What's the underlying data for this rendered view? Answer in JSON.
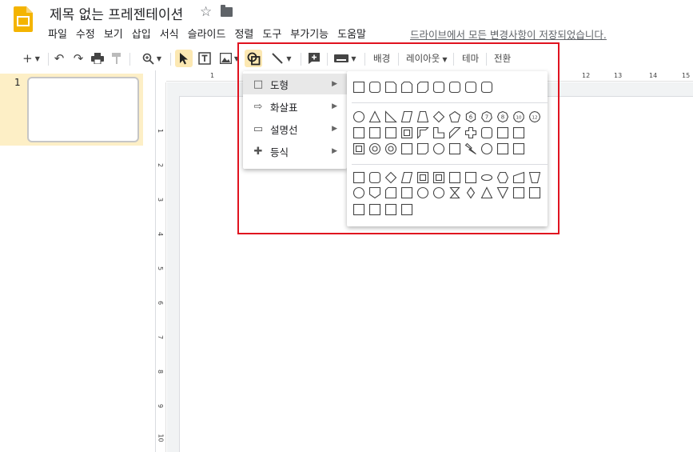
{
  "app": {
    "title": "제목 없는 프레젠테이션",
    "save_status": "드라이브에서 모든 변경사항이 저장되었습니다."
  },
  "menu": [
    "파일",
    "수정",
    "보기",
    "삽입",
    "서식",
    "슬라이드",
    "정렬",
    "도구",
    "부가기능",
    "도움말"
  ],
  "toolbar": {
    "background_label": "배경",
    "layout_label": "레이아웃",
    "theme_label": "테마",
    "transition_label": "전환"
  },
  "slides": [
    {
      "number": "1"
    }
  ],
  "rulers": {
    "horizontal": [
      "1",
      "12",
      "13",
      "14",
      "15"
    ],
    "vertical": [
      "1",
      "2",
      "3",
      "4",
      "5",
      "6",
      "7",
      "8",
      "9",
      "10"
    ]
  },
  "shape_menu": {
    "items": [
      {
        "label": "도형",
        "icon": "rectangle-icon"
      },
      {
        "label": "화살표",
        "icon": "arrow-right-icon"
      },
      {
        "label": "설명선",
        "icon": "callout-icon"
      },
      {
        "label": "등식",
        "icon": "plus-icon"
      }
    ]
  },
  "shape_panel": {
    "rows": [
      {
        "group": "rectangles",
        "shapes": [
          "rectangle",
          "rounded-rectangle",
          "snip-single-corner",
          "snip-same-side",
          "snip-diagonal",
          "snip-round-single",
          "round-single-corner",
          "round-same-side",
          "round-diagonal"
        ]
      },
      {
        "group": "basic",
        "shapes": [
          "oval",
          "triangle",
          "right-triangle",
          "parallelogram",
          "trapezoid",
          "diamond",
          "pentagon",
          "hexagon-6",
          "heptagon-7",
          "octagon-8",
          "decagon-10",
          "dodecagon-12"
        ]
      },
      {
        "group": "basic",
        "shapes": [
          "pie",
          "chord",
          "teardrop",
          "frame",
          "half-frame",
          "l-shape",
          "diagonal-stripe",
          "cross",
          "plaque",
          "can",
          "cube"
        ]
      },
      {
        "group": "basic",
        "shapes": [
          "bevel",
          "donut",
          "no-symbol",
          "block-arc",
          "folded-corner",
          "smiley",
          "heart",
          "lightning-bolt",
          "sun",
          "moon",
          "cloud"
        ]
      },
      {
        "group": "flowchart",
        "shapes": [
          "process",
          "alternate-process",
          "decision",
          "data",
          "predefined-process",
          "internal-storage",
          "document",
          "multidocument",
          "terminator",
          "preparation",
          "manual-input",
          "manual-operation"
        ]
      },
      {
        "group": "flowchart",
        "shapes": [
          "connector",
          "off-page-connector",
          "card",
          "punched-tape",
          "summing-junction",
          "or",
          "collate",
          "sort",
          "extract",
          "merge",
          "stored-data",
          "delay"
        ]
      },
      {
        "group": "flowchart",
        "shapes": [
          "sequential-access",
          "magnetic-disk",
          "direct-access",
          "display"
        ]
      }
    ]
  },
  "colors": {
    "accent": "#fce8b2",
    "selection": "#fdefc6",
    "highlight": "#e0121f",
    "logo": "#f4b400"
  }
}
